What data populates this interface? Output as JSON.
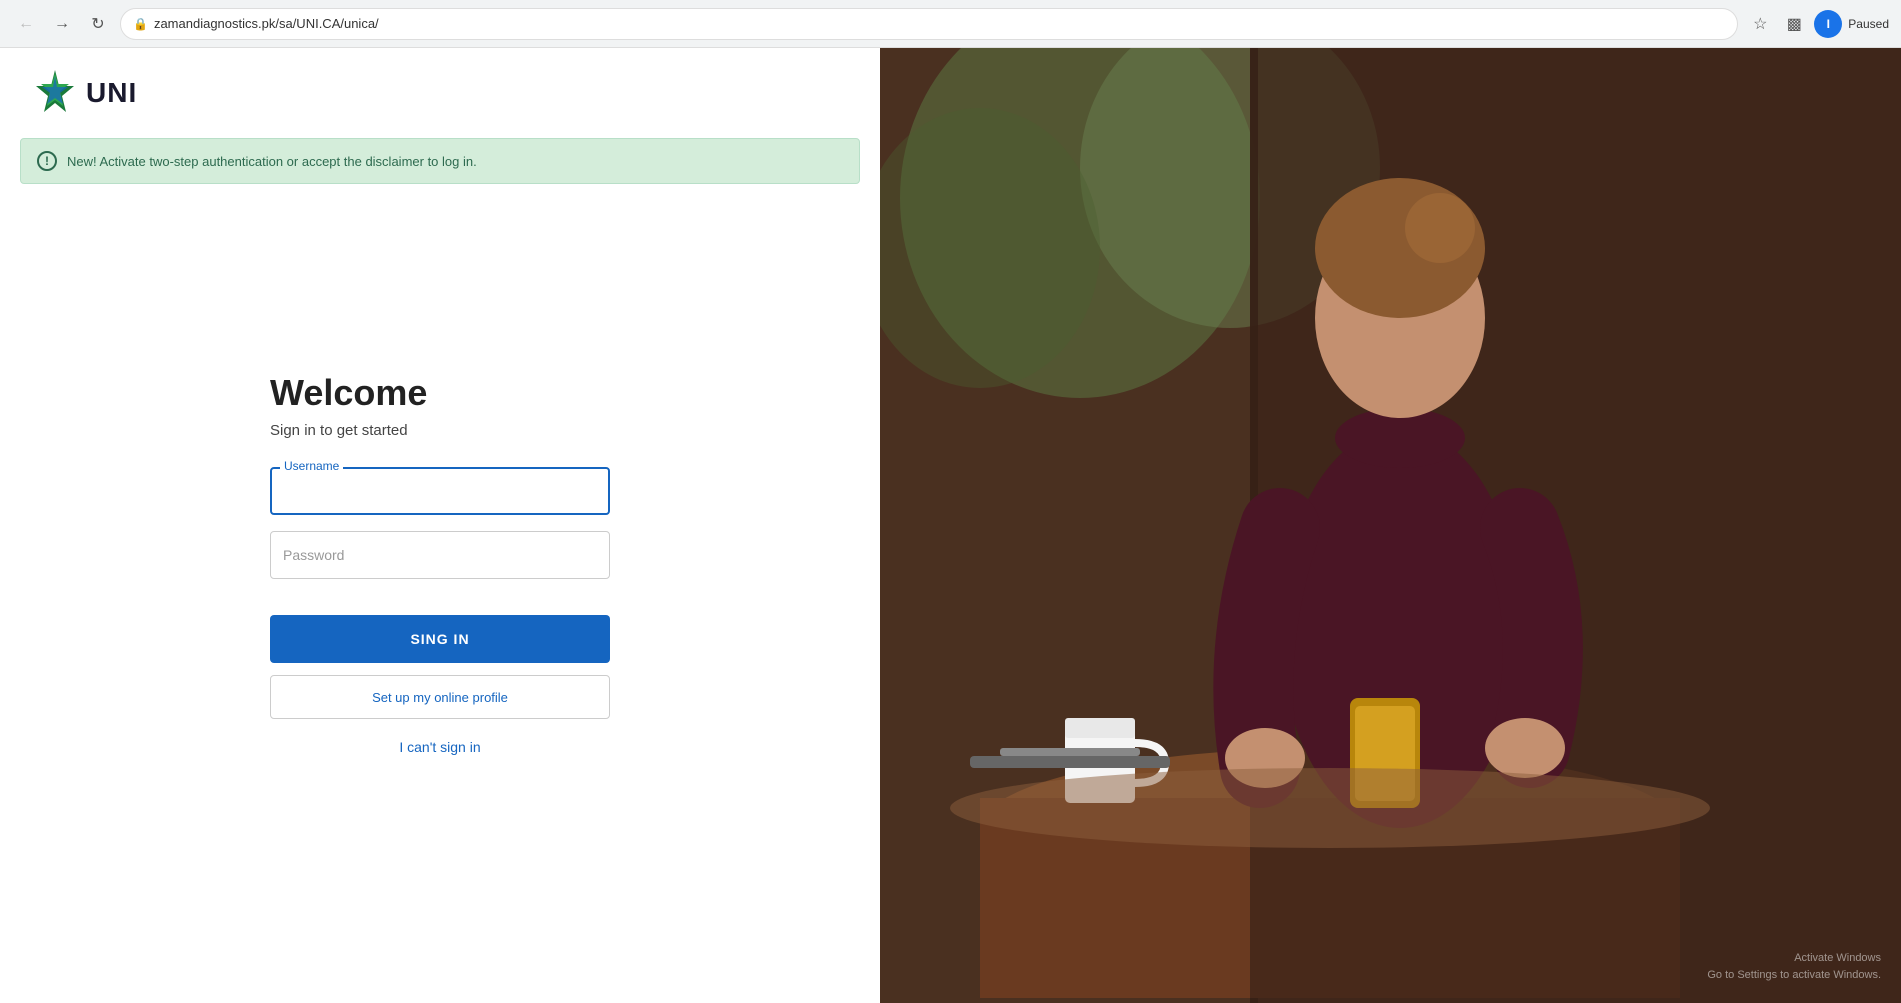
{
  "browser": {
    "url": "zamandiagnostics.pk/sa/UNI.CA/unica/",
    "back_disabled": true,
    "forward_disabled": true,
    "paused_label": "Paused",
    "profile_initial": "I"
  },
  "header": {
    "logo_text": "UNI"
  },
  "alert": {
    "message": "New! Activate two-step authentication or accept the disclaimer to log in."
  },
  "form": {
    "title": "Welcome",
    "subtitle": "Sign in to get started",
    "username_label": "Username",
    "username_placeholder": "",
    "password_placeholder": "Password",
    "signin_button": "SING IN",
    "setup_profile_button": "Set up my online profile",
    "cant_signin_link": "I can't sign in"
  },
  "watermark": {
    "line1": "Activate Windows",
    "line2": "Go to Settings to activate Windows."
  }
}
